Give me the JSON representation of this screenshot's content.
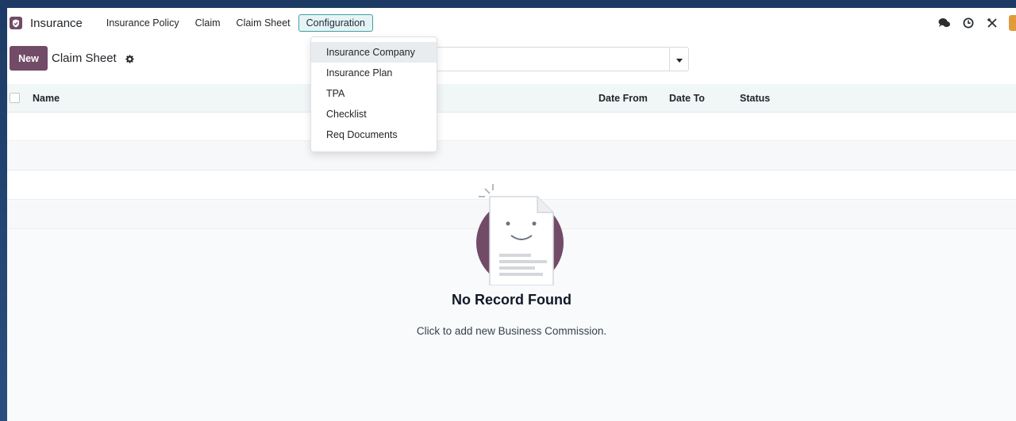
{
  "navbar": {
    "app_name": "Insurance",
    "menu": [
      {
        "label": "Insurance Policy"
      },
      {
        "label": "Claim"
      },
      {
        "label": "Claim Sheet"
      },
      {
        "label": "Configuration"
      }
    ],
    "icons": [
      "chat-icon",
      "clock-icon",
      "tools-icon"
    ]
  },
  "control_panel": {
    "new_label": "New",
    "title": "Claim Sheet",
    "search_placeholder": ""
  },
  "configuration_menu": {
    "items": [
      {
        "label": "Insurance Company"
      },
      {
        "label": "Insurance Plan"
      },
      {
        "label": "TPA"
      },
      {
        "label": "Checklist"
      },
      {
        "label": "Req Documents"
      }
    ]
  },
  "list": {
    "columns": [
      "Name",
      "Date From",
      "Date To",
      "Status"
    ]
  },
  "empty_state": {
    "title": "No Record Found",
    "text": "Click to add new Business Commission."
  },
  "colors": {
    "brand": "#714b67",
    "active_border": "#3fa0a8",
    "user_badge": "#e39a3b"
  }
}
